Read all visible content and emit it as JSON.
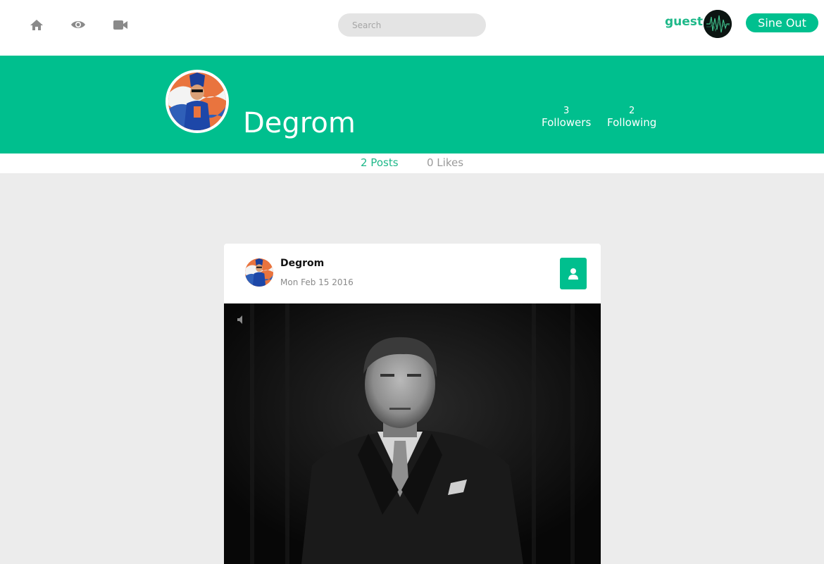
{
  "nav": {
    "icons": [
      "home-icon",
      "eye-icon",
      "video-camera-icon"
    ],
    "search": {
      "placeholder": "Search",
      "value": ""
    },
    "user_name": "guest",
    "signout_label": "Sine Out"
  },
  "profile": {
    "name": "Degrom",
    "followers_count": "3",
    "followers_label": "Followers",
    "following_count": "2",
    "following_label": "Following"
  },
  "tabs": {
    "posts_label": "2 Posts",
    "likes_label": "0 Likes"
  },
  "post": {
    "author": "Degrom",
    "date": "Mon Feb 15 2016",
    "follow_icon": "user-icon",
    "video_control_icon": "volume-icon"
  },
  "colors": {
    "accent": "#00bf8e",
    "accent_text": "#1eb889",
    "page_bg": "#ececec",
    "icon_gray": "#8a8a8a"
  }
}
